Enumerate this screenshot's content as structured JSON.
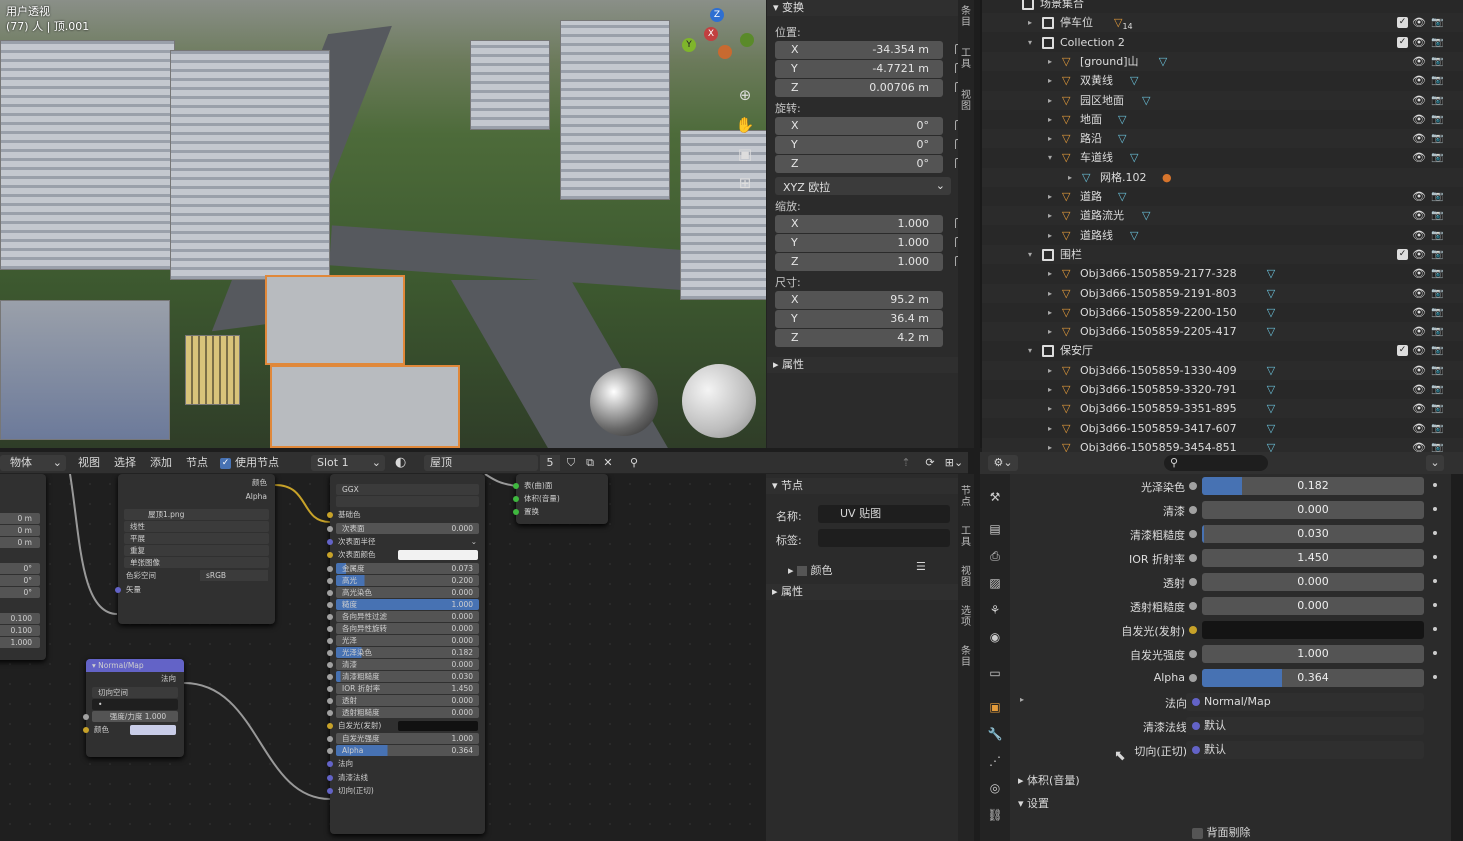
{
  "viewport": {
    "title": "用户透视",
    "subtitle": "(77) 人 | 顶.001"
  },
  "transform": {
    "header": "变换",
    "location_label": "位置:",
    "rotation_label": "旋转:",
    "scale_label": "缩放:",
    "dimensions_label": "尺寸:",
    "location": [
      {
        "axis": "X",
        "value": "-34.354 m"
      },
      {
        "axis": "Y",
        "value": "-4.7721 m"
      },
      {
        "axis": "Z",
        "value": "0.00706 m"
      }
    ],
    "rotation": [
      {
        "axis": "X",
        "value": "0°"
      },
      {
        "axis": "Y",
        "value": "0°"
      },
      {
        "axis": "Z",
        "value": "0°"
      }
    ],
    "rotation_mode": "XYZ 欧拉",
    "scale": [
      {
        "axis": "X",
        "value": "1.000"
      },
      {
        "axis": "Y",
        "value": "1.000"
      },
      {
        "axis": "Z",
        "value": "1.000"
      }
    ],
    "dimensions": [
      {
        "axis": "X",
        "value": "95.2 m"
      },
      {
        "axis": "Y",
        "value": "36.4 m"
      },
      {
        "axis": "Z",
        "value": "4.2 m"
      }
    ],
    "properties_header": "属性"
  },
  "npanel_tabs": [
    "条目",
    "工具",
    "视图"
  ],
  "outliner": {
    "rows": [
      {
        "name": "场景集合",
        "indent": 0,
        "type": "collection",
        "tri": ""
      },
      {
        "name": "停车位",
        "indent": 1,
        "type": "collection",
        "tri": "▸",
        "badge": "14",
        "check": true
      },
      {
        "name": "Collection 2",
        "indent": 1,
        "type": "collection",
        "tri": "▾",
        "check": true
      },
      {
        "name": "[ground]山",
        "indent": 2,
        "type": "object",
        "tri": "▸"
      },
      {
        "name": "双黄线",
        "indent": 2,
        "type": "object",
        "tri": "▸"
      },
      {
        "name": "园区地面",
        "indent": 2,
        "type": "object",
        "tri": "▸"
      },
      {
        "name": "地面",
        "indent": 2,
        "type": "object",
        "tri": "▸"
      },
      {
        "name": "路沿",
        "indent": 2,
        "type": "object",
        "tri": "▸"
      },
      {
        "name": "车道线",
        "indent": 2,
        "type": "object",
        "tri": "▾"
      },
      {
        "name": "网格.102",
        "indent": 3,
        "type": "mesh",
        "tri": "▸"
      },
      {
        "name": "道路",
        "indent": 2,
        "type": "object",
        "tri": "▸"
      },
      {
        "name": "道路流光",
        "indent": 2,
        "type": "object",
        "tri": "▸"
      },
      {
        "name": "道路线",
        "indent": 2,
        "type": "object",
        "tri": "▸"
      },
      {
        "name": "围栏",
        "indent": 1,
        "type": "collection",
        "tri": "▾",
        "check": true
      },
      {
        "name": "Obj3d66-1505859-2177-328",
        "indent": 2,
        "type": "object",
        "tri": "▸"
      },
      {
        "name": "Obj3d66-1505859-2191-803",
        "indent": 2,
        "type": "object",
        "tri": "▸"
      },
      {
        "name": "Obj3d66-1505859-2200-150",
        "indent": 2,
        "type": "object",
        "tri": "▸"
      },
      {
        "name": "Obj3d66-1505859-2205-417",
        "indent": 2,
        "type": "object",
        "tri": "▸"
      },
      {
        "name": "保安厅",
        "indent": 1,
        "type": "collection",
        "tri": "▾",
        "check": true
      },
      {
        "name": "Obj3d66-1505859-1330-409",
        "indent": 2,
        "type": "object",
        "tri": "▸"
      },
      {
        "name": "Obj3d66-1505859-3320-791",
        "indent": 2,
        "type": "object",
        "tri": "▸"
      },
      {
        "name": "Obj3d66-1505859-3351-895",
        "indent": 2,
        "type": "object",
        "tri": "▸"
      },
      {
        "name": "Obj3d66-1505859-3417-607",
        "indent": 2,
        "type": "object",
        "tri": "▸"
      },
      {
        "name": "Obj3d66-1505859-3454-851",
        "indent": 2,
        "type": "object",
        "tri": "▸"
      }
    ]
  },
  "node_header": {
    "mode": "物体",
    "menus": [
      "视图",
      "选择",
      "添加",
      "节点"
    ],
    "use_nodes": "使用节点",
    "slot": "Slot 1",
    "material": "屋顶",
    "users": "5"
  },
  "node_editor": {
    "left_vals": [
      "0 m",
      "0 m",
      "0 m",
      "0°",
      "0°",
      "0°",
      "0.100",
      "0.100",
      "1.000"
    ],
    "image_node": {
      "out_color": "颜色",
      "out_alpha": "Alpha",
      "image": "屋顶1.png",
      "interp": "线性",
      "proj": "平展",
      "ext": "重复",
      "src": "单张图像",
      "cs_label": "色彩空间",
      "cs": "sRGB",
      "vector": "矢量"
    },
    "normal_node": {
      "title": "Normal/Map",
      "out": "法向",
      "space": "切向空间",
      "uv": "•",
      "strength_label": "强度/力度",
      "strength": "1.000",
      "color": "颜色"
    },
    "bsdf": {
      "dist": "GGX",
      "sss": "",
      "rows": [
        {
          "l": "基础色",
          "t": "label",
          "s": "y"
        },
        {
          "l": "次表面",
          "v": "0.000",
          "s": "g"
        },
        {
          "l": "次表面半径",
          "v": "",
          "t": "sel",
          "s": "b"
        },
        {
          "l": "次表面颜色",
          "t": "color",
          "s": "y"
        },
        {
          "l": "金属度",
          "v": "0.073",
          "f": 7,
          "s": "g"
        },
        {
          "l": "高光",
          "v": "0.200",
          "f": 20,
          "s": "g"
        },
        {
          "l": "高光染色",
          "v": "0.000",
          "s": "g"
        },
        {
          "l": "糙度",
          "v": "1.000",
          "f": 100,
          "s": "g"
        },
        {
          "l": "各向异性过滤",
          "v": "0.000",
          "s": "g"
        },
        {
          "l": "各向异性旋转",
          "v": "0.000",
          "s": "g"
        },
        {
          "l": "光泽",
          "v": "0.000",
          "s": "g"
        },
        {
          "l": "光泽染色",
          "v": "0.182",
          "f": 18,
          "s": "g"
        },
        {
          "l": "清漆",
          "v": "0.000",
          "s": "g"
        },
        {
          "l": "清漆粗糙度",
          "v": "0.030",
          "f": 3,
          "s": "g"
        },
        {
          "l": "IOR 折射率",
          "v": "1.450",
          "s": "g"
        },
        {
          "l": "透射",
          "v": "0.000",
          "s": "g"
        },
        {
          "l": "透射粗糙度",
          "v": "0.000",
          "s": "g"
        },
        {
          "l": "自发光(发射)",
          "t": "dark",
          "s": "y"
        },
        {
          "l": "自发光强度",
          "v": "1.000",
          "s": "g"
        },
        {
          "l": "Alpha",
          "v": "0.364",
          "f": 36,
          "s": "g"
        },
        {
          "l": "法向",
          "t": "label",
          "s": "b"
        },
        {
          "l": "清漆法线",
          "t": "label",
          "s": "b"
        },
        {
          "l": "切向(正切)",
          "t": "label",
          "s": "b"
        }
      ]
    },
    "output": {
      "rows": [
        "表(曲)面",
        "体积(音量)",
        "置换"
      ]
    }
  },
  "node_panel": {
    "header": "节点",
    "name_label": "名称:",
    "name": "UV 贴图",
    "label_label": "标签:",
    "color": "颜色",
    "props": "属性"
  },
  "node_tabs": [
    "节点",
    "工具",
    "视图",
    "选项",
    "条目"
  ],
  "props": {
    "rows": [
      {
        "l": "光泽染色",
        "v": "0.182",
        "f": 18
      },
      {
        "l": "清漆",
        "v": "0.000",
        "f": 0
      },
      {
        "l": "清漆粗糙度",
        "v": "0.030",
        "f": 1
      },
      {
        "l": "IOR 折射率",
        "v": "1.450",
        "f": 0
      },
      {
        "l": "透射",
        "v": "0.000",
        "f": 0
      },
      {
        "l": "透射粗糙度",
        "v": "0.000",
        "f": 0
      },
      {
        "l": "自发光(发射)",
        "t": "black"
      },
      {
        "l": "自发光强度",
        "v": "1.000",
        "f": 0
      },
      {
        "l": "Alpha",
        "v": "0.364",
        "f": 36
      }
    ],
    "links": [
      {
        "l": "法向",
        "v": "Normal/Map"
      },
      {
        "l": "清漆法线",
        "v": "默认"
      },
      {
        "l": "切向(正切)",
        "v": "默认"
      }
    ],
    "volume": "体积(音量)",
    "settings": "设置",
    "backface": "背面剔除"
  }
}
